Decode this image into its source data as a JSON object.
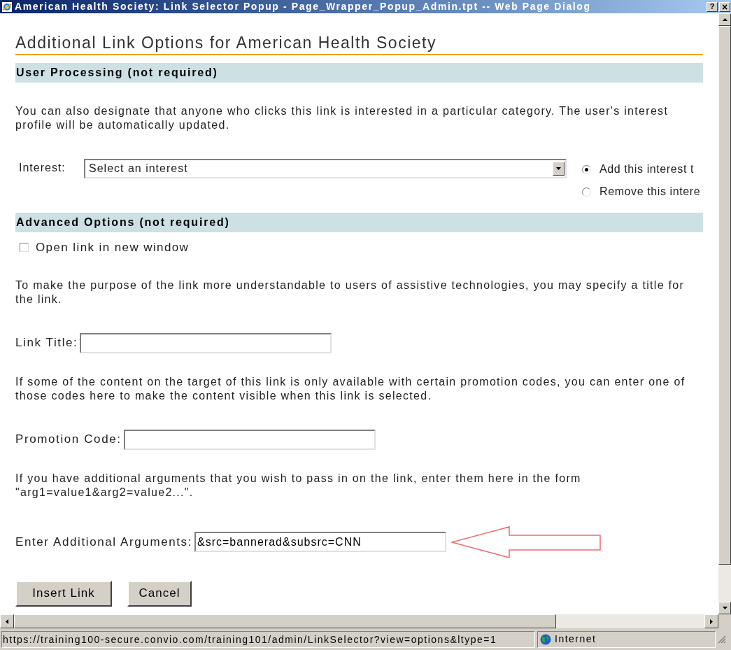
{
  "window": {
    "title": "American Health Society: Link Selector Popup - Page_Wrapper_Popup_Admin.tpt -- Web Page Dialog",
    "help": "?",
    "close": "×"
  },
  "heading": "Additional Link Options for American Health Society",
  "sections": [
    {
      "title": "User Processing (not required)",
      "items": [
        {
          "kind": "paragraph",
          "text": "You can also designate that anyone who clicks this link is interested in a particular category. The user's interest profile will be automatically updated."
        },
        {
          "kind": "select",
          "label": "Interest:",
          "value": "Select an interest",
          "options": [
            {
              "label": "Add this interest t",
              "selected": true
            },
            {
              "label": "Remove this intere",
              "selected": false
            }
          ]
        }
      ]
    },
    {
      "title": "Advanced Options (not required)",
      "items": [
        {
          "kind": "checkbox",
          "label": "Open link in new window",
          "checked": false
        },
        {
          "kind": "paragraph",
          "text": "To make the purpose of the link more understandable to users of assistive technologies, you may specify a title for the link."
        },
        {
          "kind": "field",
          "label": "Link Title:",
          "value": "",
          "annotated": false
        },
        {
          "kind": "paragraph",
          "text": "If some of the content on the target of this link is only available with certain promotion codes, you can enter one of those codes here to make the content visible when this link is selected."
        },
        {
          "kind": "field",
          "label": "Promotion Code:",
          "value": "",
          "annotated": false
        },
        {
          "kind": "paragraph",
          "text": "If you have additional arguments that you wish to pass in on the link, enter them here in the form \"arg1=value1&arg2=value2...\"."
        },
        {
          "kind": "field",
          "label": "Enter Additional Arguments:",
          "value": "&src=bannerad&subsrc=CNN",
          "annotated": true
        }
      ]
    }
  ],
  "buttons": [
    "Insert Link",
    "Cancel"
  ],
  "status_bar": {
    "url": "https://training100-secure.convio.com/training101/admin/LinkSelector?view=options&ltype=1",
    "zone": "Internet"
  }
}
